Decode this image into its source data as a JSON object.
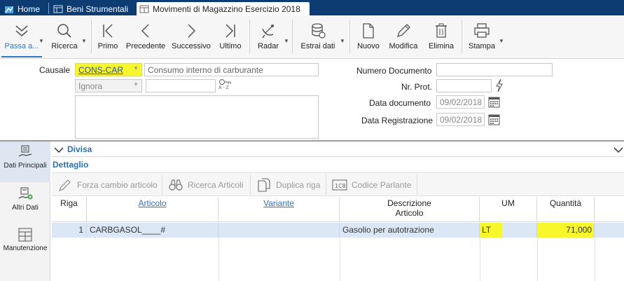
{
  "tabs": [
    {
      "label": "Home"
    },
    {
      "label": "Beni Strumentali"
    },
    {
      "label": "Movimenti di Magazzino Esercizio 2018"
    }
  ],
  "toolbar": {
    "passa_a": "Passa a...",
    "ricerca": "Ricerca",
    "primo": "Primo",
    "precedente": "Precedente",
    "successivo": "Successivo",
    "ultimo": "Ultimo",
    "radar": "Radar",
    "estrai_dati": "Estrai dati",
    "nuovo": "Nuovo",
    "modifica": "Modifica",
    "elimina": "Elimina",
    "stampa": "Stampa"
  },
  "form": {
    "causale_label": "Causale",
    "causale_code": "CONS-CAR",
    "causale_desc": "Consumo interno di carburante",
    "ignora": "Ignora",
    "az_label": "A - Z",
    "numero_documento_label": "Numero Documento",
    "numero_documento": "",
    "nr_prot_label": "Nr. Prot.",
    "nr_prot": "",
    "data_documento_label": "Data documento",
    "data_documento": "09/02/2018",
    "data_registrazione_label": "Data Registrazione",
    "data_registrazione": "09/02/2018"
  },
  "nav": [
    {
      "label": "Dati Principali"
    },
    {
      "label": "Altri Dati"
    },
    {
      "label": "Manutenzione"
    }
  ],
  "sections": {
    "divisa": "Divisa",
    "dettaglio": "Dettaglio"
  },
  "detail_toolbar": {
    "forza_cambio": "Forza cambio articolo",
    "ricerca_articoli": "Ricerca Articoli",
    "duplica_riga": "Duplica riga",
    "codice_parlante": "Codice Parlante"
  },
  "grid": {
    "headers": {
      "riga": "Riga",
      "articolo": "Articolo",
      "variante": "Variante",
      "descrizione_1": "Descrizione",
      "descrizione_2": "Articolo",
      "um": "UM",
      "quantita": "Quantità"
    },
    "rows": [
      {
        "riga": "1",
        "articolo": "CARBGASOL____#",
        "variante": "",
        "descrizione": "Gasolio per autotrazione",
        "um": "LT",
        "quantita": "71,000"
      }
    ]
  },
  "colors": {
    "tabbar": "#0d3c73",
    "highlight": "#f7f72b",
    "accent_link": "#2a6fb8",
    "row_selected": "#dbe7f4"
  }
}
